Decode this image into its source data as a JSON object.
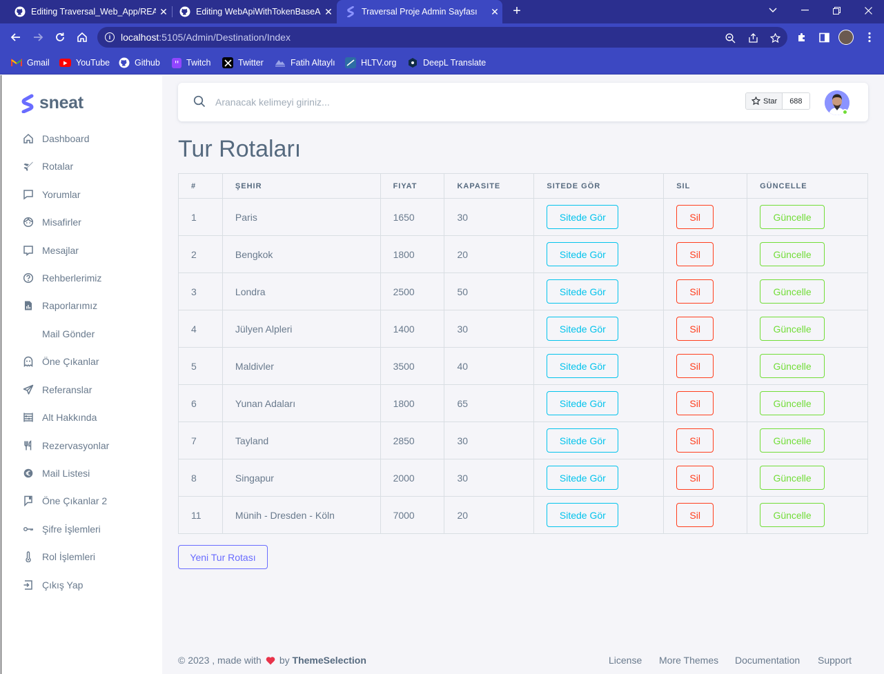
{
  "browser": {
    "tabs": [
      {
        "title": "Editing Traversal_Web_App/READ",
        "close": "✕"
      },
      {
        "title": "Editing WebApiWithTokenBaseA",
        "close": "✕"
      },
      {
        "title": "Traversal Proje Admin Sayfası",
        "close": "✕"
      }
    ],
    "new_tab": "+",
    "url_host": "localhost",
    "url_path": ":5105/Admin/Destination/Index",
    "bookmarks": [
      "Gmail",
      "YouTube",
      "Github",
      "Twitch",
      "Twitter",
      "Fatih Altaylı",
      "HLTV.org",
      "DeepL Translate"
    ],
    "accent": "#3c48c2"
  },
  "sidebar": {
    "logo": "sneat",
    "items": [
      {
        "label": "Dashboard",
        "icon": "home-icon"
      },
      {
        "label": "Rotalar",
        "icon": "plane-icon"
      },
      {
        "label": "Yorumlar",
        "icon": "comment-icon"
      },
      {
        "label": "Misafirler",
        "icon": "face-icon"
      },
      {
        "label": "Mesajlar",
        "icon": "message-icon"
      },
      {
        "label": "Rehberlerimiz",
        "icon": "help-circle-icon"
      },
      {
        "label": "Raporlarımız",
        "icon": "report-icon"
      },
      {
        "label": "Mail Gönder",
        "icon": ""
      },
      {
        "label": "Öne Çıkanlar",
        "icon": "ghost-icon"
      },
      {
        "label": "Referanslar",
        "icon": "send-icon"
      },
      {
        "label": "Alt Hakkında",
        "icon": "abacus-icon"
      },
      {
        "label": "Rezervasyonlar",
        "icon": "restaurant-icon"
      },
      {
        "label": "Mail Listesi",
        "icon": "euro-icon"
      },
      {
        "label": "Öne Çıkanlar 2",
        "icon": "book-icon"
      },
      {
        "label": "Şifre İşlemleri",
        "icon": "key-icon"
      },
      {
        "label": "Rol İşlemleri",
        "icon": "thermometer-icon"
      },
      {
        "label": "Çıkış Yap",
        "icon": "logout-icon"
      }
    ]
  },
  "navbar": {
    "search_placeholder": "Aranacak kelimeyi giriniz...",
    "star_label": "Star",
    "star_count": "688"
  },
  "main": {
    "title": "Tur Rotaları",
    "columns": [
      "#",
      "ŞEHIR",
      "FIYAT",
      "KAPASITE",
      "SITEDE GÖR",
      "SIL",
      "GÜNCELLE"
    ],
    "rows": [
      {
        "id": "1",
        "city": "Paris",
        "price": "1650",
        "capacity": "30"
      },
      {
        "id": "2",
        "city": "Bengkok",
        "price": "1800",
        "capacity": "20"
      },
      {
        "id": "3",
        "city": "Londra",
        "price": "2500",
        "capacity": "50"
      },
      {
        "id": "4",
        "city": "Jülyen Alpleri",
        "price": "1400",
        "capacity": "30"
      },
      {
        "id": "5",
        "city": "Maldivler",
        "price": "3500",
        "capacity": "40"
      },
      {
        "id": "6",
        "city": "Yunan Adaları",
        "price": "1800",
        "capacity": "65"
      },
      {
        "id": "7",
        "city": "Tayland",
        "price": "2850",
        "capacity": "30"
      },
      {
        "id": "8",
        "city": "Singapur",
        "price": "2000",
        "capacity": "30"
      },
      {
        "id": "11",
        "city": "Münih - Dresden - Köln",
        "price": "7000",
        "capacity": "20"
      }
    ],
    "view_label": "Sitede Gör",
    "delete_label": "Sil",
    "update_label": "Güncelle",
    "new_button": "Yeni Tur Rotası"
  },
  "footer": {
    "copy_prefix": "© 2023 , made with",
    "copy_by": "by",
    "brand": "ThemeSelection",
    "links": [
      "License",
      "More Themes",
      "Documentation",
      "Support"
    ]
  }
}
